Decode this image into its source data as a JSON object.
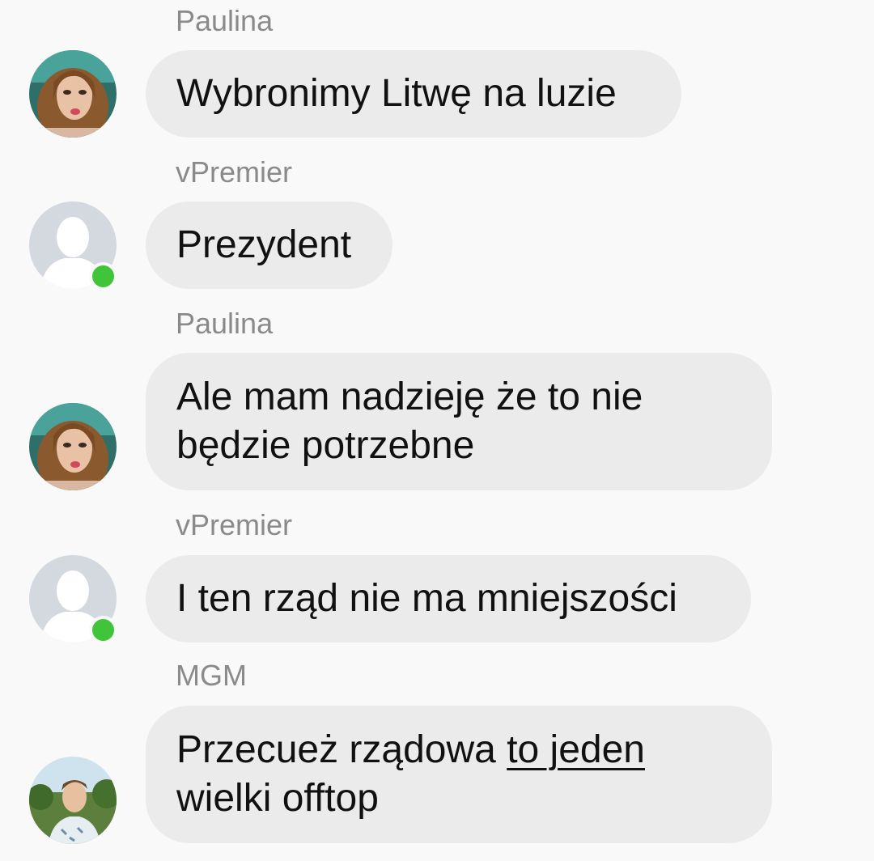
{
  "messages": [
    {
      "sender": "Paulina",
      "text": "Wybronimy Litwę na luzie",
      "avatar": "woman-avatar"
    },
    {
      "sender": "vPremier",
      "text": "Prezydent",
      "avatar": "default-user-avatar",
      "online": true
    },
    {
      "sender": "Paulina",
      "text": "Ale mam nadzieję że to nie będzie potrzebne",
      "avatar": "woman-avatar"
    },
    {
      "sender": "vPremier",
      "text": "I ten rząd nie ma mniejszości",
      "avatar": "default-user-avatar",
      "online": true
    },
    {
      "sender": "MGM",
      "text_before": "Przecueż rządowa ",
      "link_text": "to jeden",
      "text_after": " wielki offtop",
      "avatar": "man-avatar"
    }
  ],
  "colors": {
    "background": "#f9f9f9",
    "bubble": "#ebebeb",
    "sender_name": "#8a8a8a",
    "online": "#3fc43a"
  }
}
